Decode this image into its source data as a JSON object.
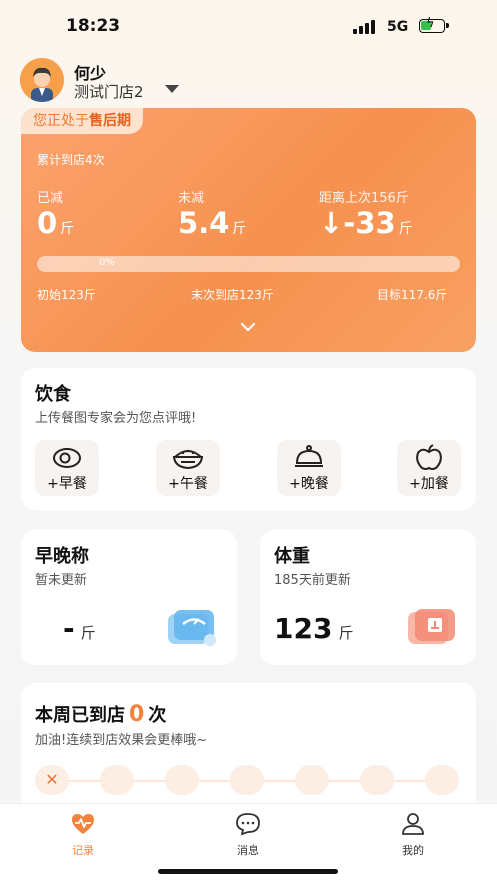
{
  "status_bar": {
    "time": "18:23",
    "network": "5G"
  },
  "profile": {
    "name": "何少",
    "store": "测试门店2"
  },
  "summary": {
    "phase_prefix": "您正处于",
    "phase_name": "售后期",
    "visit_total": "累计到店4次",
    "reduced": {
      "label": "已减",
      "value": "0",
      "unit": "斤"
    },
    "remaining": {
      "label": "未减",
      "value": "5.4",
      "unit": "斤"
    },
    "since_last": {
      "label": "距离上次156斤",
      "value": "↓-33",
      "unit": "斤"
    },
    "progress": {
      "percent": 0,
      "text": "0%"
    },
    "initial": "初始123斤",
    "last_visit": "末次到店123斤",
    "target": "目标117.6斤"
  },
  "diet": {
    "title": "饮食",
    "subtitle": "上传餐图专家会为您点评哦!",
    "meals": [
      {
        "label": "+早餐",
        "icon": "egg-icon"
      },
      {
        "label": "+午餐",
        "icon": "rice-bowl-icon"
      },
      {
        "label": "+晚餐",
        "icon": "cloche-icon"
      },
      {
        "label": "+加餐",
        "icon": "apple-icon"
      }
    ]
  },
  "scale": {
    "title": "早晚称",
    "subtitle": "暂未更新",
    "value": "-",
    "unit": "斤",
    "icon": "scale-icon"
  },
  "weight": {
    "title": "体重",
    "subtitle": "185天前更新",
    "value": "123",
    "unit": "斤",
    "icon": "weight-chart-icon"
  },
  "week": {
    "title_prefix": "本周已到店",
    "count": "0",
    "title_suffix": "次",
    "subtitle": "加油!连续到店效果会更棒哦~",
    "miss_mark": "✕"
  },
  "tabs": [
    {
      "label": "记录",
      "icon": "heart-pulse-icon",
      "active": true
    },
    {
      "label": "消息",
      "icon": "chat-bubble-icon",
      "active": false
    },
    {
      "label": "我的",
      "icon": "person-icon",
      "active": false
    }
  ],
  "colors": {
    "accent": "#f2823e",
    "card_orange": "#f6914f"
  }
}
